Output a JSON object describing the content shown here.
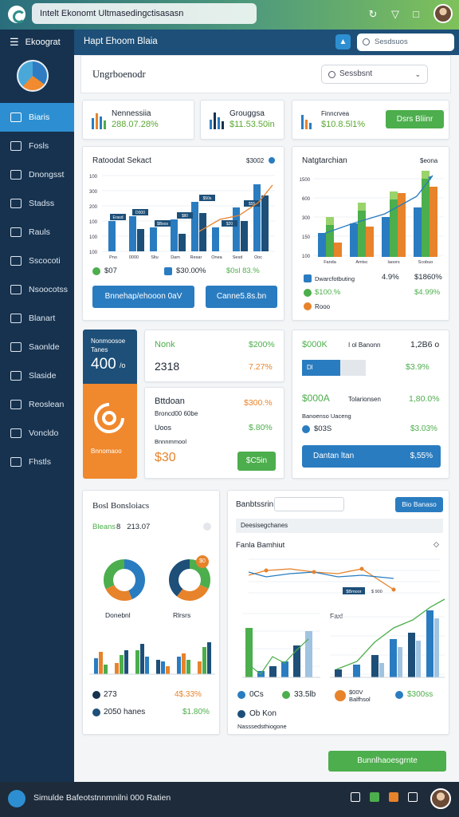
{
  "topbar": {
    "url": "Intelt Ekonomt Ultmasedingctisasasn"
  },
  "sidebar": {
    "title": "Ekoograt",
    "items": [
      {
        "label": "Biaris",
        "active": true
      },
      {
        "label": "Fosls"
      },
      {
        "label": "Dnongsst"
      },
      {
        "label": "Stadss"
      },
      {
        "label": "Rauls"
      },
      {
        "label": "Sscocoti"
      },
      {
        "label": "Nsoocotss"
      },
      {
        "label": "Blanart"
      },
      {
        "label": "Saonlde"
      },
      {
        "label": "Slaside"
      },
      {
        "label": "Reoslean"
      },
      {
        "label": "Voncldo"
      },
      {
        "label": "Fhstls"
      }
    ]
  },
  "header": {
    "title": "Hapt Ehoom Blaia",
    "search_placeholder": "Sesdsuos"
  },
  "page": {
    "title": "Ungrboenodr",
    "search_value": "Sessbsnt"
  },
  "kpis": [
    {
      "name": "Nennessiia",
      "value": "288.07.28%"
    },
    {
      "name": "Grouggsa",
      "value": "$11.53.50in"
    },
    {
      "name": "Finncrvea",
      "value": "$10.8.5l1%"
    }
  ],
  "kpi_button": "Dsrs Bliinr",
  "revenue_card": {
    "title": "Ratoodat Sekact",
    "badge": "$3002",
    "ylabels": [
      "100",
      "300",
      "200",
      "100",
      "100",
      "100"
    ],
    "xlabels": [
      "Pno",
      "0000",
      "Sltu",
      "Dam",
      "Resar",
      "Onea",
      "Sesd",
      "Qoc"
    ],
    "bar_labels": [
      "Erasd",
      "D000",
      "$Bsos",
      "$ll0",
      "$50s",
      "$20",
      "$55"
    ],
    "stats": [
      "$07",
      "$30.00%",
      "$0sl 83.%"
    ],
    "btn1": "Bnnehap/ehooon 0aV",
    "btn2": "Canne5.8s.bn"
  },
  "right_chart_card": {
    "title": "Natgtarchian",
    "badge": "$eona",
    "ylabels": [
      "1500",
      "600",
      "300",
      "150",
      "100"
    ],
    "xlabels": [
      "Fanda",
      "Amtsc",
      "Iaoors",
      "Scobuo"
    ],
    "legend": [
      "Dwarcfotbuting",
      "$100.%",
      "Rooo"
    ],
    "values": [
      "4.9%",
      "$1860%",
      "$4.99%"
    ]
  },
  "mid_left": {
    "promo_label": "Nonmoosoe\nTanes",
    "promo_value": "400",
    "promo_unit": "/o",
    "promo_caption": "Bnnomaoo",
    "row1_title": "Nonk",
    "row1_value": "2318",
    "row1_pct": "$200%",
    "row1_pct2": "7.27%",
    "row2_title": "Bttdoan",
    "row2_sub": "Broncd00 60be",
    "row2_sub2": "Uoos",
    "row2_pct": "$300.%",
    "row2_pct2": "$.80%",
    "row2_note": "Bnnnmmool",
    "row2_value": "$30",
    "row2_btn": "$C5in"
  },
  "mid_right": {
    "title": "$000K",
    "title_sub": "I ol Banonn",
    "title_value": "1,2B6 o",
    "progress_label": "Dl",
    "progress_value": "$3.9%",
    "row2_title": "$000A",
    "row2_sub": "Tolarionsen",
    "row2_value": "1,80.0%",
    "row2_note": "Banoenso Uaceng",
    "row2_stat": "$03S",
    "row2_stat2": "$3.03%",
    "btn": "Dantan ltan",
    "btn_value": "$,55%"
  },
  "bottom_left": {
    "title": "Bosl Bonsloiacs",
    "sub_label": "Bleans",
    "sub_value": "8   213.07",
    "donut1_label": "Donebnl",
    "donut2_label": "Rlrsrs",
    "donut2_badge": "$0",
    "stat1": "273",
    "stat1_pct": "4$.33%",
    "stat2": "2050 hanes",
    "stat2_pct": "$1.80%"
  },
  "bottom_right": {
    "title": "Banbtssrin",
    "button": "Bio Banaso",
    "filter": "Deesisegchanes",
    "section_title": "Fanla Bamhiut",
    "line_labels": [
      "$Bmoor",
      "$ 900"
    ],
    "chart2_title": "Faxl",
    "stats": [
      "0Cs",
      "33.5lb",
      "$00V Balfhsol",
      "$300ss"
    ],
    "bottom_label": "Ob Kon",
    "bottom_sub": "Nasssedsthiogone"
  },
  "bottom_button": "Bunnlhaoesgrnte",
  "footer": {
    "text": "Simulde Bafeotstnnmnilni 000 Ratien"
  }
}
